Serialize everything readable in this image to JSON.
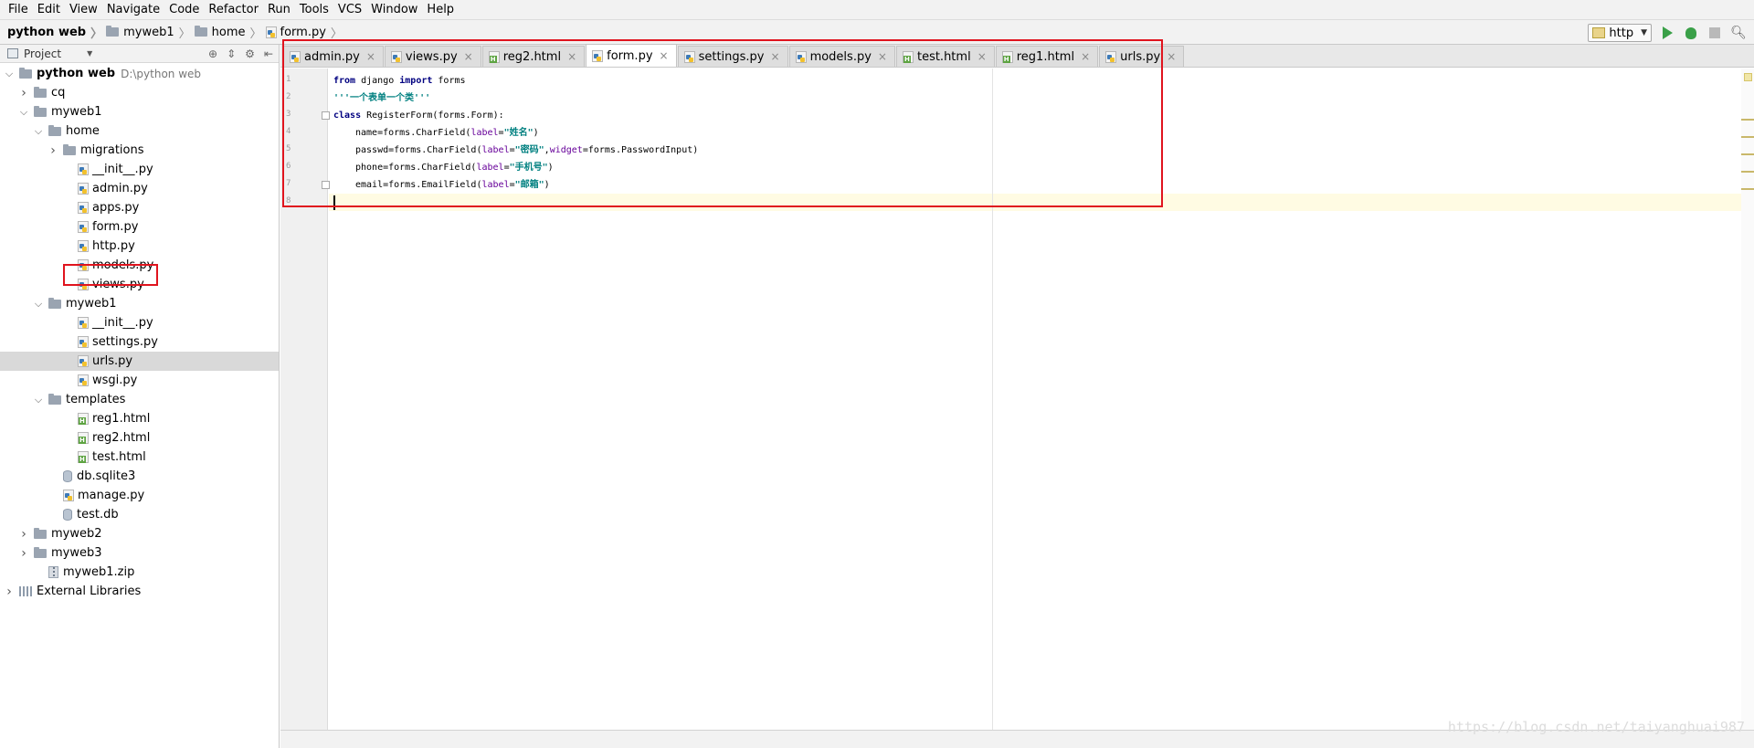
{
  "menu": [
    "File",
    "Edit",
    "View",
    "Navigate",
    "Code",
    "Refactor",
    "Run",
    "Tools",
    "VCS",
    "Window",
    "Help"
  ],
  "breadcrumb": [
    {
      "label": "python web",
      "icon": "folder",
      "bold": true
    },
    {
      "label": "myweb1",
      "icon": "folder",
      "bold": false
    },
    {
      "label": "home",
      "icon": "folder",
      "bold": false
    },
    {
      "label": "form.py",
      "icon": "python-file",
      "bold": false
    }
  ],
  "run_config": {
    "label": "http"
  },
  "project_panel": {
    "label": "Project"
  },
  "tree": [
    {
      "label": "python web",
      "path": "D:\\python web",
      "depth": 0,
      "arrow": "down",
      "icon": "folder",
      "root": true
    },
    {
      "label": "cq",
      "depth": 1,
      "arrow": "right",
      "icon": "folder"
    },
    {
      "label": "myweb1",
      "depth": 1,
      "arrow": "down",
      "icon": "folder"
    },
    {
      "label": "home",
      "depth": 2,
      "arrow": "down",
      "icon": "folder"
    },
    {
      "label": "migrations",
      "depth": 3,
      "arrow": "right",
      "icon": "folder"
    },
    {
      "label": "__init__.py",
      "depth": 4,
      "icon": "python-file"
    },
    {
      "label": "admin.py",
      "depth": 4,
      "icon": "python-file"
    },
    {
      "label": "apps.py",
      "depth": 4,
      "icon": "python-file"
    },
    {
      "label": "form.py",
      "depth": 4,
      "icon": "python-file",
      "highlight": true
    },
    {
      "label": "http.py",
      "depth": 4,
      "icon": "python-file"
    },
    {
      "label": "models.py",
      "depth": 4,
      "icon": "python-file"
    },
    {
      "label": "views.py",
      "depth": 4,
      "icon": "python-file"
    },
    {
      "label": "myweb1",
      "depth": 2,
      "arrow": "down",
      "icon": "folder"
    },
    {
      "label": "__init__.py",
      "depth": 4,
      "icon": "python-file"
    },
    {
      "label": "settings.py",
      "depth": 4,
      "icon": "python-file"
    },
    {
      "label": "urls.py",
      "depth": 4,
      "icon": "python-file",
      "selected": true
    },
    {
      "label": "wsgi.py",
      "depth": 4,
      "icon": "python-file"
    },
    {
      "label": "templates",
      "depth": 2,
      "arrow": "down",
      "icon": "folder"
    },
    {
      "label": "reg1.html",
      "depth": 4,
      "icon": "html-file"
    },
    {
      "label": "reg2.html",
      "depth": 4,
      "icon": "html-file"
    },
    {
      "label": "test.html",
      "depth": 4,
      "icon": "html-file"
    },
    {
      "label": "db.sqlite3",
      "depth": 3,
      "icon": "database"
    },
    {
      "label": "manage.py",
      "depth": 3,
      "icon": "python-file"
    },
    {
      "label": "test.db",
      "depth": 3,
      "icon": "database"
    },
    {
      "label": "myweb2",
      "depth": 1,
      "arrow": "right",
      "icon": "folder"
    },
    {
      "label": "myweb3",
      "depth": 1,
      "arrow": "right",
      "icon": "folder"
    },
    {
      "label": "myweb1.zip",
      "depth": 2,
      "icon": "zip"
    },
    {
      "label": "External Libraries",
      "depth": 0,
      "arrow": "right",
      "icon": "library"
    }
  ],
  "tabs": [
    {
      "label": "admin.py",
      "icon": "python-file",
      "active": false
    },
    {
      "label": "views.py",
      "icon": "python-file",
      "active": false
    },
    {
      "label": "reg2.html",
      "icon": "html-file",
      "active": false
    },
    {
      "label": "form.py",
      "icon": "python-file",
      "active": true
    },
    {
      "label": "settings.py",
      "icon": "python-file",
      "active": false
    },
    {
      "label": "models.py",
      "icon": "python-file",
      "active": false
    },
    {
      "label": "test.html",
      "icon": "html-file",
      "active": false
    },
    {
      "label": "reg1.html",
      "icon": "html-file",
      "active": false
    },
    {
      "label": "urls.py",
      "icon": "python-file",
      "active": false
    }
  ],
  "code": [
    {
      "no": "1",
      "indent": 0,
      "tokens": [
        [
          "kw",
          "from"
        ],
        [
          "plain",
          " django "
        ],
        [
          "kw",
          "import"
        ],
        [
          "plain",
          " forms"
        ]
      ]
    },
    {
      "no": "2",
      "indent": 0,
      "tokens": [
        [
          "str",
          "'''一个表单一个类'''"
        ]
      ]
    },
    {
      "no": "3",
      "indent": 0,
      "tokens": [
        [
          "kw",
          "class"
        ],
        [
          "plain",
          " RegisterForm(forms.Form):"
        ]
      ]
    },
    {
      "no": "4",
      "indent": 1,
      "tokens": [
        [
          "plain",
          "name=forms.CharField("
        ],
        [
          "kwarg",
          "label"
        ],
        [
          "plain",
          "="
        ],
        [
          "str",
          "\"姓名\""
        ],
        [
          "plain",
          ")"
        ]
      ]
    },
    {
      "no": "5",
      "indent": 1,
      "tokens": [
        [
          "plain",
          "passwd=forms.CharField("
        ],
        [
          "kwarg",
          "label"
        ],
        [
          "plain",
          "="
        ],
        [
          "str",
          "\"密码\""
        ],
        [
          "plain",
          ","
        ],
        [
          "kwarg",
          "widget"
        ],
        [
          "plain",
          "=forms.PasswordInput)"
        ]
      ]
    },
    {
      "no": "6",
      "indent": 1,
      "tokens": [
        [
          "plain",
          "phone=forms.CharField("
        ],
        [
          "kwarg",
          "label"
        ],
        [
          "plain",
          "="
        ],
        [
          "str",
          "\"手机号\""
        ],
        [
          "plain",
          ")"
        ]
      ]
    },
    {
      "no": "7",
      "indent": 1,
      "tokens": [
        [
          "plain",
          "email=forms.EmailField("
        ],
        [
          "kwarg",
          "label"
        ],
        [
          "plain",
          "="
        ],
        [
          "str",
          "\"邮箱\""
        ],
        [
          "plain",
          ")"
        ]
      ]
    },
    {
      "no": "8",
      "indent": 0,
      "tokens": []
    }
  ],
  "watermark": "https://blog.csdn.net/taiyanghuai987",
  "colors": {
    "highlight_box": "#e0141e",
    "keyword": "#000080",
    "string": "#008080",
    "kwarg": "#660099"
  }
}
